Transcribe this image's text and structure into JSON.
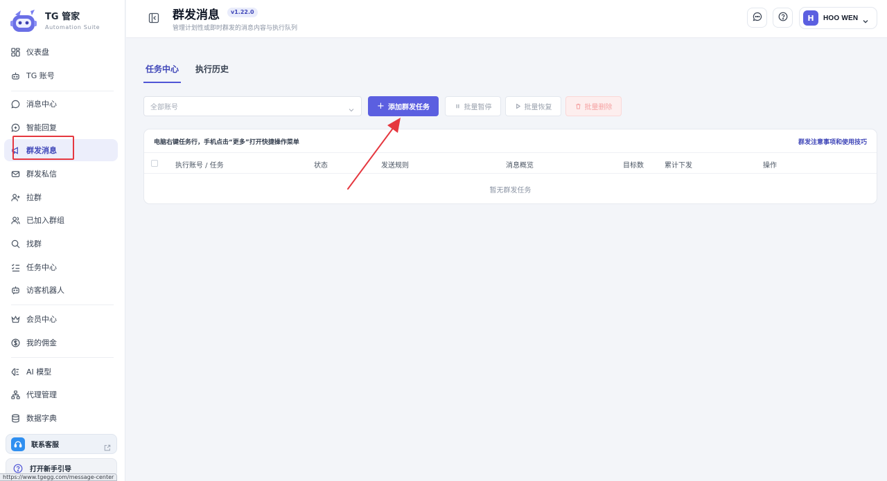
{
  "brand": {
    "title": "TG 管家",
    "subtitle": "Automation Suite"
  },
  "sidebar": {
    "items": [
      {
        "label": "仪表盘",
        "icon": "dashboard-icon"
      },
      {
        "label": "TG 账号",
        "icon": "robot-icon"
      },
      {
        "label": "消息中心",
        "icon": "chat-bubble-icon"
      },
      {
        "label": "智能回复",
        "icon": "smart-reply-icon"
      },
      {
        "label": "群发消息",
        "icon": "megaphone-icon",
        "active": true
      },
      {
        "label": "群发私信",
        "icon": "mail-icon"
      },
      {
        "label": "拉群",
        "icon": "user-plus-icon"
      },
      {
        "label": "已加入群组",
        "icon": "users-icon"
      },
      {
        "label": "找群",
        "icon": "search-icon"
      },
      {
        "label": "任务中心",
        "icon": "task-list-icon"
      },
      {
        "label": "访客机器人",
        "icon": "bot-chat-icon"
      },
      {
        "label": "会员中心",
        "icon": "crown-icon"
      },
      {
        "label": "我的佣金",
        "icon": "dollar-icon"
      },
      {
        "label": "AI 模型",
        "icon": "ai-brain-icon"
      },
      {
        "label": "代理管理",
        "icon": "network-icon"
      },
      {
        "label": "数据字典",
        "icon": "database-icon"
      }
    ],
    "support_label": "联系客服",
    "guide_label": "打开新手引导"
  },
  "statusbar": {
    "url": "https://www.tgegg.com/message-center"
  },
  "header": {
    "title": "群发消息",
    "version": "v1.22.0",
    "subtitle": "管理计划性或即时群发的消息内容与执行队列",
    "user_initial": "H",
    "user_name": "HOO WEN"
  },
  "tabs": [
    {
      "label": "任务中心",
      "active": true
    },
    {
      "label": "执行历史",
      "active": false
    }
  ],
  "toolbar": {
    "account_placeholder": "全部账号",
    "add_label": "添加群发任务",
    "pause_label": "批量暂停",
    "resume_label": "批量恢复",
    "delete_label": "批量删除"
  },
  "table": {
    "tip": "电脑右键任务行，手机点击“更多”打开快捷操作菜单",
    "help_link": "群发注意事项和使用技巧",
    "columns": [
      "执行账号 / 任务",
      "状态",
      "发送规则",
      "消息概览",
      "目标数",
      "累计下发",
      "操作"
    ],
    "empty_text": "暂无群发任务"
  },
  "colors": {
    "accent": "#5b5fe0",
    "active_text": "#3f46b8",
    "annotation": "#e5373f"
  }
}
